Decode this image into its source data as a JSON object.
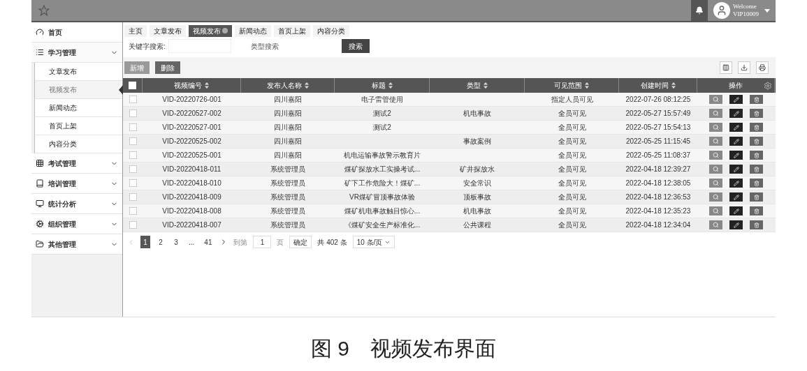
{
  "header": {
    "welcome": "Welcome",
    "user": "VIP10009"
  },
  "sidebar": {
    "items": [
      {
        "label": "首页"
      },
      {
        "label": "学习管理",
        "expanded": true,
        "children": [
          {
            "label": "文章发布",
            "selected": false
          },
          {
            "label": "视频发布",
            "selected": true
          },
          {
            "label": "新闻动态",
            "selected": false
          },
          {
            "label": "首页上架",
            "selected": false
          },
          {
            "label": "内容分类",
            "selected": false
          }
        ]
      },
      {
        "label": "考试管理"
      },
      {
        "label": "培训管理"
      },
      {
        "label": "统计分析"
      },
      {
        "label": "组织管理"
      },
      {
        "label": "其他管理"
      }
    ]
  },
  "tabs": [
    {
      "label": "主页",
      "selected": false
    },
    {
      "label": "文章发布",
      "selected": false
    },
    {
      "label": "视频发布",
      "selected": true
    },
    {
      "label": "新闻动态",
      "selected": false
    },
    {
      "label": "首页上架",
      "selected": false
    },
    {
      "label": "内容分类",
      "selected": false
    }
  ],
  "search": {
    "keyword_label": "关键字搜索:",
    "type_placeholder": "类型搜索",
    "button": "搜索"
  },
  "toolbar": {
    "add": "新增",
    "delete": "删除"
  },
  "table": {
    "select_all_checked": false,
    "columns": [
      "视频编号",
      "发布人名称",
      "标题",
      "类型",
      "可见范围",
      "创建时间",
      "操作"
    ],
    "rows": [
      {
        "checked": false,
        "cells": [
          "VID-20220726-001",
          "四川嘉阳",
          "电子雷管使用",
          "",
          "指定人员可见",
          "2022-07-26 08:12:25"
        ]
      },
      {
        "checked": false,
        "cells": [
          "VID-20220527-002",
          "四川嘉阳",
          "测试2",
          "机电事故",
          "全员可见",
          "2022-05-27 15:57:49"
        ]
      },
      {
        "checked": false,
        "cells": [
          "VID-20220527-001",
          "四川嘉阳",
          "测试2",
          "",
          "全员可见",
          "2022-05-27 15:54:13"
        ]
      },
      {
        "checked": false,
        "cells": [
          "VID-20220525-002",
          "四川嘉阳",
          "",
          "事故案例",
          "全员可见",
          "2022-05-25 11:15:45"
        ]
      },
      {
        "checked": false,
        "cells": [
          "VID-20220525-001",
          "四川嘉阳",
          "机电运输事故警示教育片",
          "",
          "全员可见",
          "2022-05-25 11:08:37"
        ]
      },
      {
        "checked": false,
        "cells": [
          "VID-20220418-011",
          "系统管理员",
          "煤矿探放水工实操考试...",
          "矿井探放水",
          "全员可见",
          "2022-04-18 12:39:27"
        ]
      },
      {
        "checked": false,
        "cells": [
          "VID-20220418-010",
          "系统管理员",
          "矿下工作危险大！煤矿...",
          "安全常识",
          "全员可见",
          "2022-04-18 12:38:05"
        ]
      },
      {
        "checked": false,
        "cells": [
          "VID-20220418-009",
          "系统管理员",
          "VR煤矿冒顶事故体验",
          "顶板事故",
          "全员可见",
          "2022-04-18 12:36:53"
        ]
      },
      {
        "checked": false,
        "cells": [
          "VID-20220418-008",
          "系统管理员",
          "煤矿机电事故触目惊心...",
          "机电事故",
          "全员可见",
          "2022-04-18 12:35:23"
        ]
      },
      {
        "checked": false,
        "cells": [
          "VID-20220418-007",
          "系统管理员",
          "《煤矿安全生产标准化...",
          "公共课程",
          "全员可见",
          "2022-04-18 12:34:04"
        ]
      }
    ]
  },
  "pagination": {
    "pages": [
      {
        "label": "1",
        "selected": true
      },
      {
        "label": "2",
        "selected": false
      },
      {
        "label": "3",
        "selected": false
      },
      {
        "label": "...",
        "selected": false
      },
      {
        "label": "41",
        "selected": false
      }
    ],
    "goto_label": "到第",
    "goto_value": "1",
    "page_unit": "页",
    "confirm": "确定",
    "total": "共 402 条",
    "page_size": "10 条/页"
  },
  "caption": "图 9　视频发布界面"
}
